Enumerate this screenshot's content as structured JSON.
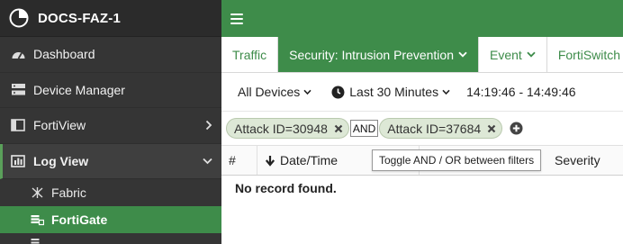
{
  "app": {
    "device_name": "DOCS-FAZ-1"
  },
  "sidebar": {
    "items": [
      {
        "label": "Dashboard",
        "icon": "dashboard-icon"
      },
      {
        "label": "Device Manager",
        "icon": "device-manager-icon"
      },
      {
        "label": "FortiView",
        "icon": "fortiview-icon"
      },
      {
        "label": "Log View",
        "icon": "log-view-icon"
      }
    ],
    "log_view_children": [
      {
        "label": "Fabric",
        "icon": "fabric-icon"
      },
      {
        "label": "FortiGate",
        "icon": "fortigate-icon"
      }
    ]
  },
  "tabs": [
    {
      "label": "Traffic"
    },
    {
      "label": "Security: Intrusion Prevention"
    },
    {
      "label": "Event"
    },
    {
      "label": "FortiSwitch"
    }
  ],
  "filters": {
    "device": "All Devices",
    "time_range": "Last 30 Minutes",
    "time_span": "14:19:46 - 14:49:46",
    "chips": [
      {
        "label": "Attack ID=30948"
      },
      {
        "label": "Attack ID=37684"
      }
    ],
    "operator": "AND"
  },
  "table": {
    "columns": {
      "num": "#",
      "date": "Date/Time",
      "severity": "Severity"
    },
    "empty_message": "No record found."
  },
  "tooltip": {
    "text": "Toggle AND / OR between filters"
  },
  "colors": {
    "accent": "#3e8c4a",
    "sidebar_bg": "#353535",
    "chip_bg": "#dde8d6"
  }
}
